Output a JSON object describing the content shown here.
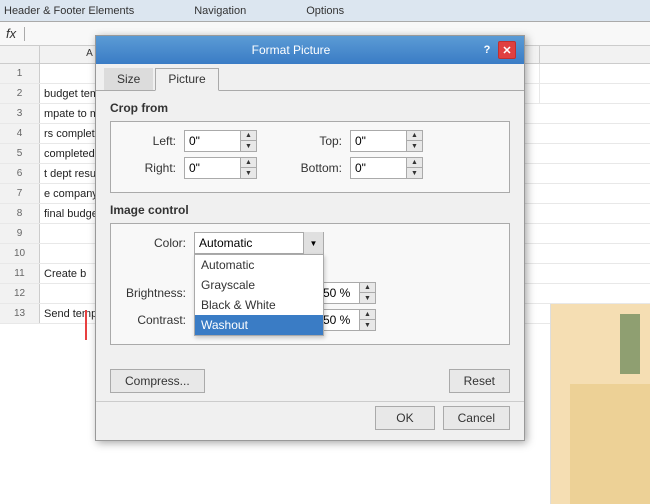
{
  "ribbon": {
    "sections": [
      "Header & Footer Elements",
      "Navigation",
      "Options"
    ]
  },
  "formulabar": {
    "fx": "fx"
  },
  "spreadsheet": {
    "col_a_label": "A",
    "rows": [
      {
        "num": "1",
        "text": ""
      },
      {
        "num": "2",
        "text": "budget template"
      },
      {
        "num": "3",
        "text": "mpate to manage"
      },
      {
        "num": "4",
        "text": "rs complete dep"
      },
      {
        "num": "5",
        "text": "completed budge"
      },
      {
        "num": "6",
        "text": "t dept results"
      },
      {
        "num": "7",
        "text": "e company budge"
      },
      {
        "num": "8",
        "text": "final budget"
      },
      {
        "num": "9",
        "text": ""
      },
      {
        "num": "10",
        "text": ""
      },
      {
        "num": "11",
        "text": "Create b"
      },
      {
        "num": "12",
        "text": ""
      },
      {
        "num": "13",
        "text": "Send tempate to managers"
      }
    ]
  },
  "dialog": {
    "title": "Format Picture",
    "help_label": "?",
    "close_label": "✕",
    "tabs": [
      {
        "label": "Size",
        "active": false
      },
      {
        "label": "Picture",
        "active": true
      }
    ],
    "crop_section": {
      "label": "Crop from",
      "left_label": "Left:",
      "left_value": "0\"",
      "right_label": "Right:",
      "right_value": "0\"",
      "top_label": "Top:",
      "top_value": "0\"",
      "bottom_label": "Bottom:",
      "bottom_value": "0\""
    },
    "image_control": {
      "label": "Image control",
      "color_label": "Color:",
      "color_value": "Automatic",
      "color_options": [
        "Automatic",
        "Grayscale",
        "Black & White",
        "Washout"
      ],
      "selected_option": "Washout",
      "brightness_label": "Brightness:",
      "brightness_value": "50 %",
      "contrast_label": "Contrast:",
      "contrast_value": "50 %"
    },
    "compress_label": "Compress...",
    "reset_label": "Reset",
    "ok_label": "OK",
    "cancel_label": "Cancel"
  }
}
